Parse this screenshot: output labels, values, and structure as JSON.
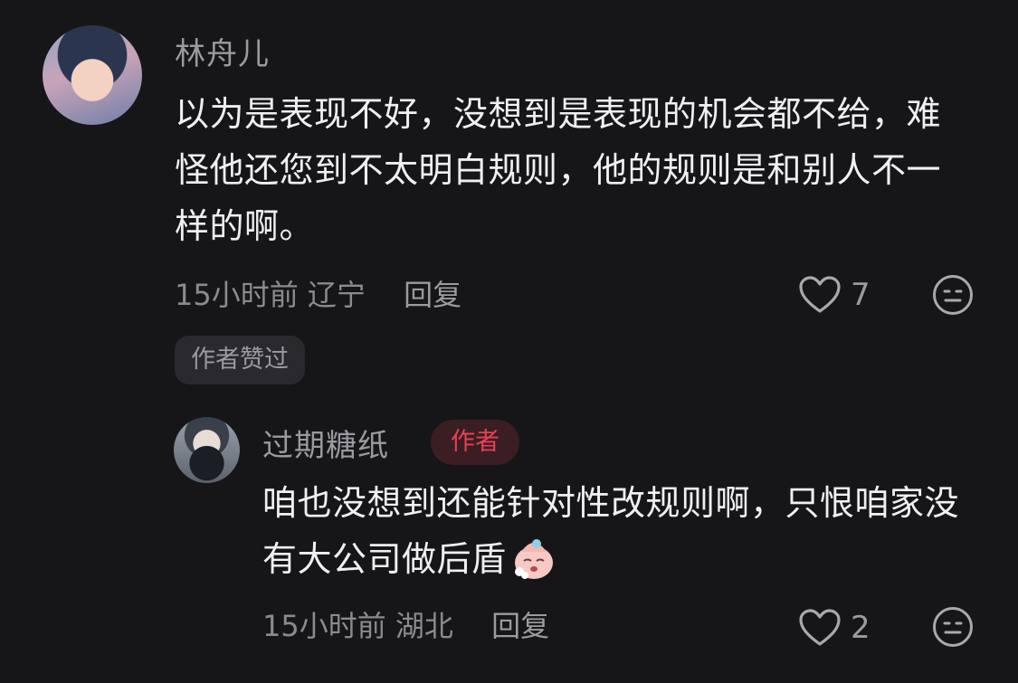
{
  "comment": {
    "username": "林舟儿",
    "text": "以为是表现不好，没想到是表现的机会都不给，难怪他还您到不太明白规则，他的规则是和别人不一样的啊。",
    "time": "15小时前",
    "location": "辽宁",
    "reply_label": "回复",
    "likes": "7",
    "liked_by_author_label": "作者赞过"
  },
  "reply": {
    "username": "过期糖纸",
    "author_badge": "作者",
    "text": "咱也没想到还能针对性改规则啊，只恨咱家没有大公司做后盾",
    "emoji": "crying-face-emoji",
    "time": "15小时前",
    "location": "湖北",
    "reply_label": "回复",
    "likes": "2"
  },
  "colors": {
    "background": "#161618",
    "author_badge_text": "#e8424f",
    "author_badge_bg": "#3a1e24"
  }
}
